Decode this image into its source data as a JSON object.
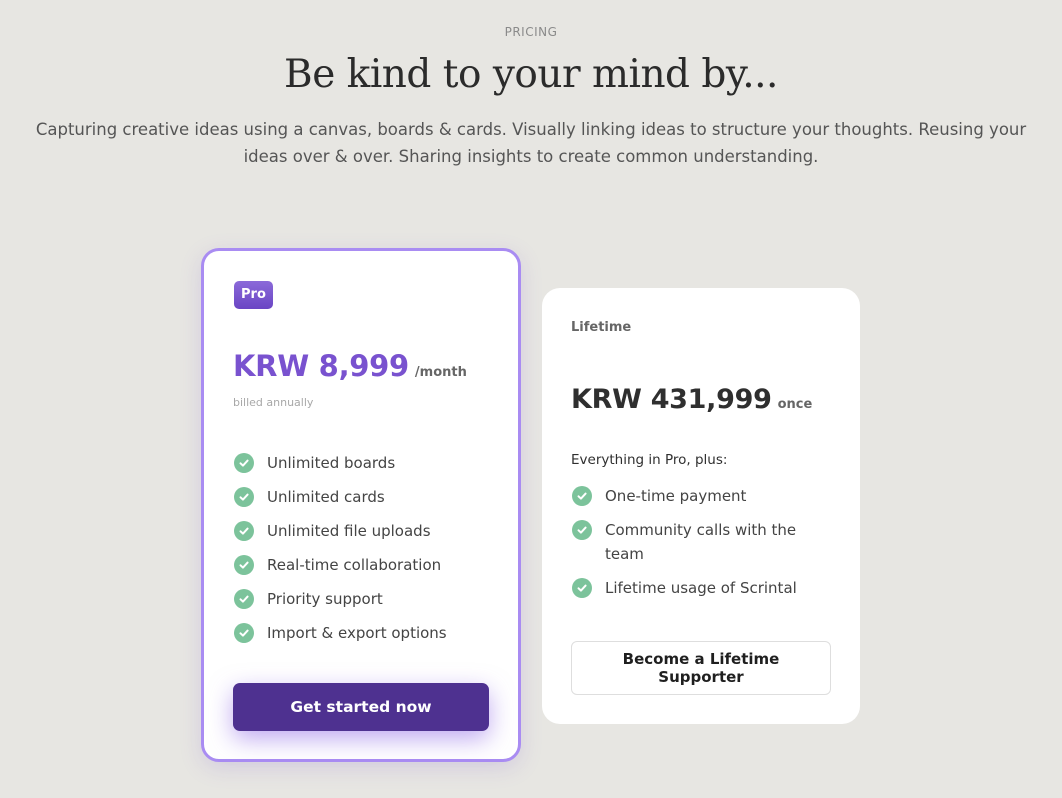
{
  "header": {
    "eyebrow": "PRICING",
    "headline": "Be kind to your mind by...",
    "subtitle": "Capturing creative ideas using a canvas, boards & cards. Visually linking ideas to structure your thoughts. Reusing your ideas over & over. Sharing insights to create common understanding."
  },
  "plans": {
    "pro": {
      "badge": "Pro",
      "price": "KRW 8,999",
      "period": "/month",
      "billing_note": "billed annually",
      "features": [
        "Unlimited boards",
        "Unlimited cards",
        "Unlimited file uploads",
        "Real-time collaboration",
        "Priority support",
        "Import & export options"
      ],
      "cta_label": "Get started now",
      "accent_color": "#7952cf",
      "border_color": "#a98cf2",
      "button_color": "#4e3190"
    },
    "lifetime": {
      "label": "Lifetime",
      "price": "KRW 431,999",
      "period": "once",
      "intro": "Everything in Pro, plus:",
      "features": [
        "One-time payment",
        "Community calls with the team",
        "Lifetime usage of Scrintal"
      ],
      "cta_label": "Become a Lifetime Supporter"
    }
  },
  "icons": {
    "feature_check": "check-circle-icon",
    "check_color": "#7cc39b"
  }
}
